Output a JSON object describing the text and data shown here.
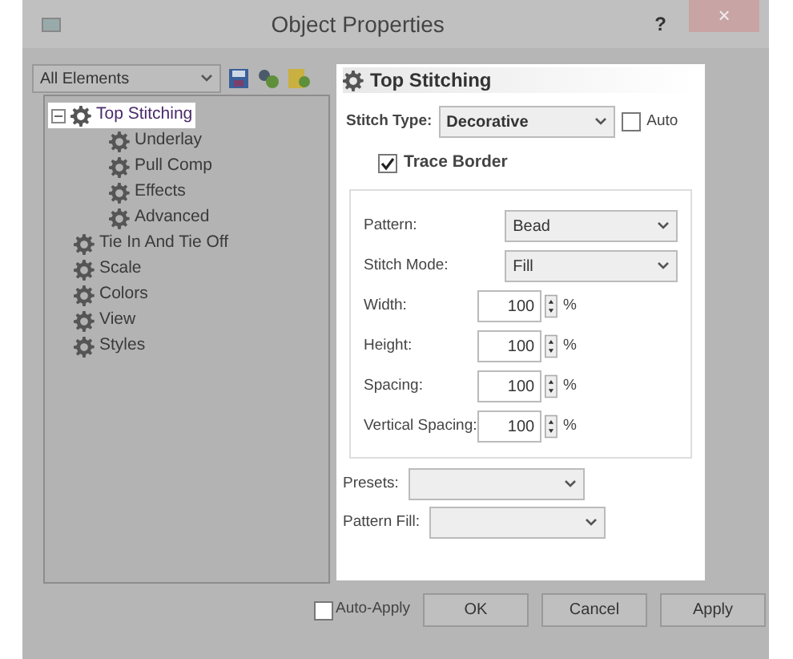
{
  "window": {
    "title": "Object Properties",
    "help": "?",
    "close": "×"
  },
  "filter": {
    "value": "All Elements"
  },
  "tree": [
    {
      "label": "Top Stitching",
      "selected": true,
      "expanded": true,
      "children": [
        {
          "label": "Underlay",
          "selected": false
        },
        {
          "label": "Pull Comp",
          "selected": false
        },
        {
          "label": "Effects",
          "selected": false
        },
        {
          "label": "Advanced",
          "selected": false
        }
      ]
    },
    {
      "label": "Tie In And Tie Off",
      "selected": false
    },
    {
      "label": "Scale",
      "selected": false
    },
    {
      "label": "Colors",
      "selected": false
    },
    {
      "label": "View",
      "selected": false
    },
    {
      "label": "Styles",
      "selected": false
    }
  ],
  "panel": {
    "title": "Top Stitching",
    "stitch_type": {
      "label": "Stitch Type:",
      "value": "Decorative"
    },
    "auto": {
      "label": "Auto",
      "checked": false
    },
    "trace_border": {
      "label": "Trace Border",
      "checked": true
    },
    "group": [
      {
        "kind": "select",
        "label": "Pattern:",
        "value": "Bead"
      },
      {
        "kind": "select",
        "label": "Stitch Mode:",
        "value": "Fill"
      },
      {
        "kind": "spin",
        "label": "Width:",
        "value": "100",
        "unit": "%"
      },
      {
        "kind": "spin",
        "label": "Height:",
        "value": "100",
        "unit": "%"
      },
      {
        "kind": "spin",
        "label": "Spacing:",
        "value": "100",
        "unit": "%"
      },
      {
        "kind": "spin",
        "label": "Vertical Spacing:",
        "value": "100",
        "unit": "%"
      }
    ],
    "presets": {
      "label": "Presets:"
    },
    "pattern_fill": {
      "label": "Pattern Fill:"
    }
  },
  "footer": {
    "auto_apply": {
      "label": "Auto-Apply",
      "checked": false
    },
    "buttons": [
      "OK",
      "Cancel",
      "Apply"
    ]
  }
}
